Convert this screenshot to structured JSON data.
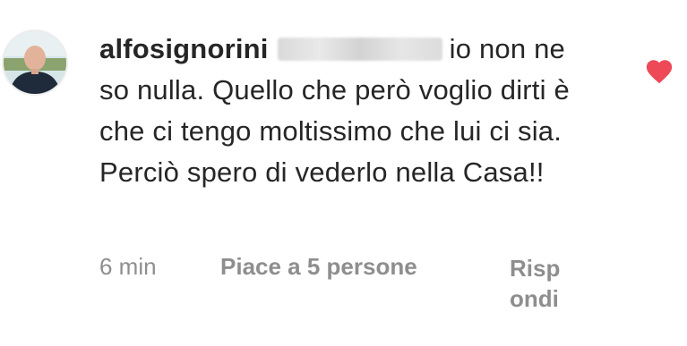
{
  "comment": {
    "username": "alfosignorini",
    "text": "io non ne so nulla. Quello che però voglio dirti è che ci tengo moltissimo che lui ci sia. Perciò spero di vederlo nella Casa!!",
    "time": "6 min",
    "likes_label": "Piace a 5 persone",
    "reply_label": "Rispondi",
    "liked": true
  },
  "icons": {
    "like": "heart-icon",
    "avatar": "profile-photo"
  },
  "colors": {
    "heart": "#ed4956",
    "meta_text": "#8e8e8e",
    "primary_text": "#262626"
  }
}
